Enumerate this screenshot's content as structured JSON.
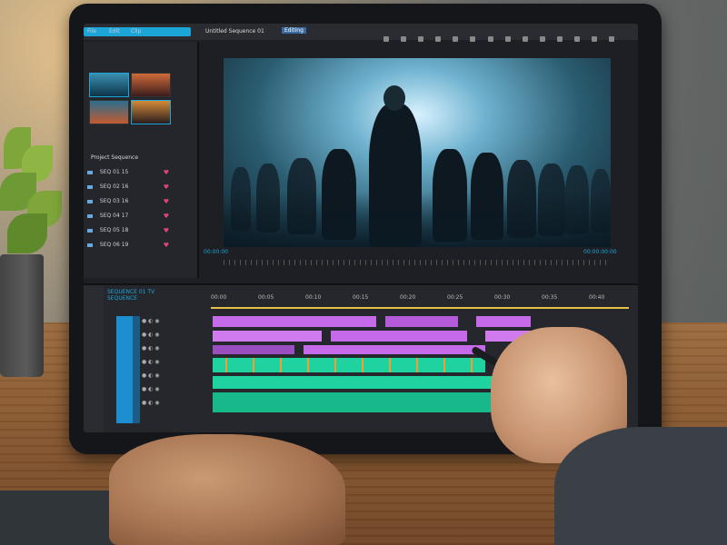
{
  "app": {
    "title_bar_title": "Untitled Sequence 01",
    "title_bar_tag": "Editing",
    "menu_left": [
      "File",
      "Edit",
      "Clip"
    ]
  },
  "project_panel": {
    "title": "Project Sequence",
    "rows": [
      {
        "label": "SEQ 01 15"
      },
      {
        "label": "SEQ 02 16"
      },
      {
        "label": "SEQ 03 16"
      },
      {
        "label": "SEQ 04 17"
      },
      {
        "label": "SEQ 05 18"
      },
      {
        "label": "SEQ 06 19"
      }
    ]
  },
  "viewer": {
    "timecode_left": "00:00:00",
    "timecode_right": "00:00:00:00"
  },
  "timeline": {
    "sequence_name_1": "SEQUENCE 01 TV",
    "sequence_name_2": "SEQUENCE",
    "ruler_ticks": [
      "00:00",
      "00:05",
      "00:10",
      "00:15",
      "00:20",
      "00:25",
      "00:30",
      "00:35",
      "00:40"
    ]
  },
  "colors": {
    "accent": "#1ca6d8",
    "clip_purple": "#c56ae8",
    "clip_green": "#1fd3a0",
    "clip_orange": "#f0a030"
  }
}
